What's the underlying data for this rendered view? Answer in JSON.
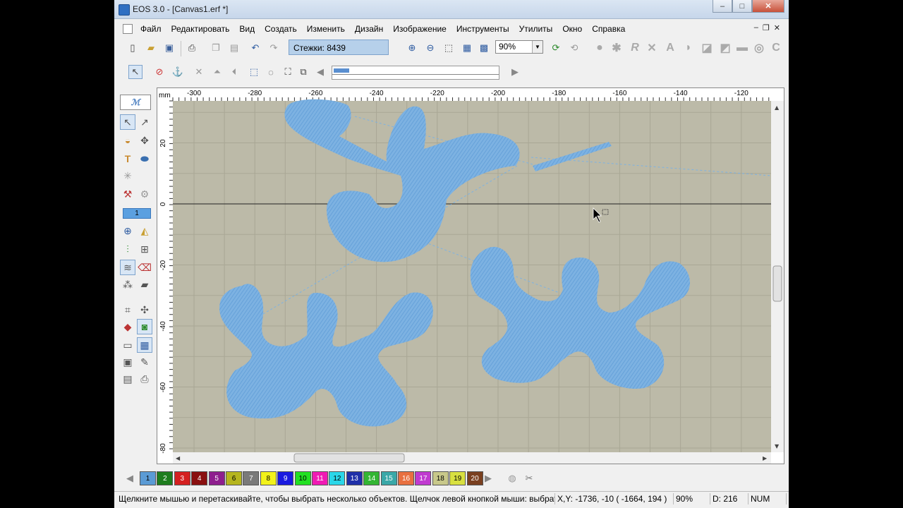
{
  "window": {
    "title": "EOS 3.0 - [Canvas1.erf *]",
    "minimize": "–",
    "maximize": "□",
    "close": "✕"
  },
  "menu": {
    "items": [
      "Файл",
      "Редактировать",
      "Вид",
      "Создать",
      "Изменить",
      "Дизайн",
      "Изображение",
      "Инструменты",
      "Утилиты",
      "Окно",
      "Справка"
    ],
    "mdi_min": "–",
    "mdi_restore": "❐",
    "mdi_close": "✕"
  },
  "toolbar": {
    "stitch_count": "Стежки: 8439",
    "zoom_value": "90%"
  },
  "ruler": {
    "unit": "mm",
    "x_ticks": [
      "-300",
      "-280",
      "-260",
      "-240",
      "-220",
      "-200",
      "-180",
      "-160",
      "-140",
      "-120"
    ],
    "y_ticks": [
      "20",
      "0",
      "-20",
      "-40",
      "-60",
      "-80"
    ]
  },
  "left_toolbar": {
    "needle_number": "1"
  },
  "palette": {
    "swatches": [
      {
        "label": "1",
        "color": "#5b9bd5"
      },
      {
        "label": "2",
        "color": "#1e7d1e"
      },
      {
        "label": "3",
        "color": "#d42020"
      },
      {
        "label": "4",
        "color": "#8a1010"
      },
      {
        "label": "5",
        "color": "#8e1f8e"
      },
      {
        "label": "6",
        "color": "#b5b51e"
      },
      {
        "label": "7",
        "color": "#7a7a7a"
      },
      {
        "label": "8",
        "color": "#f2f21a"
      },
      {
        "label": "9",
        "color": "#1a1ae0"
      },
      {
        "label": "10",
        "color": "#22e022"
      },
      {
        "label": "11",
        "color": "#f01ab4"
      },
      {
        "label": "12",
        "color": "#2ad6e8"
      },
      {
        "label": "13",
        "color": "#1f2fa8"
      },
      {
        "label": "14",
        "color": "#33b533"
      },
      {
        "label": "15",
        "color": "#3aa8a8"
      },
      {
        "label": "16",
        "color": "#e87040"
      },
      {
        "label": "17",
        "color": "#c03ad0"
      },
      {
        "label": "18",
        "color": "#c8c88a"
      },
      {
        "label": "19",
        "color": "#d8e040"
      },
      {
        "label": "20",
        "color": "#7a4020"
      }
    ]
  },
  "status": {
    "hint": "Щелкните мышью и перетаскивайте, чтобы выбрать несколько объектов. Щелчок левой кнопкой мыши: выбрать об",
    "coords": "X,Y: -1736, -10  ( -1664, 194 )",
    "zoom": "90%",
    "density": "D: 216",
    "num": "NUM"
  },
  "colors": {
    "canvas_bg": "#bcbaa8",
    "stitch_blue": "#6ea8dc",
    "grid": "#a9a795",
    "accent": "#7ea3cc"
  }
}
